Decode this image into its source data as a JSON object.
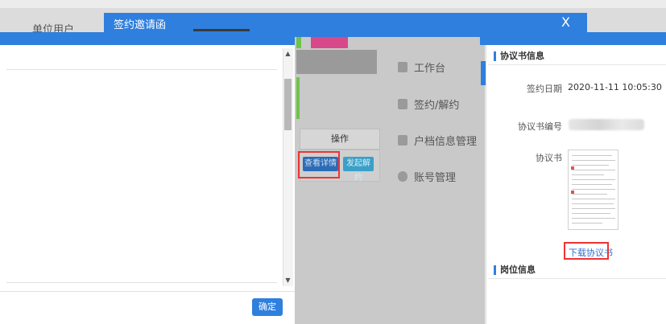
{
  "background": {
    "unit_user": "单位用户",
    "operation_header": "操作",
    "view_detail": "查看详情",
    "unsign": "发起解约",
    "nav": [
      {
        "label": "工作台",
        "icon": "calendar-icon"
      },
      {
        "label": "签约/解约",
        "icon": "document-icon"
      },
      {
        "label": "户档信息管理",
        "icon": "id-card-icon"
      },
      {
        "label": "账号管理",
        "icon": "user-icon"
      }
    ]
  },
  "dialog": {
    "title": "签约邀请函",
    "close": "X"
  },
  "left_modal": {
    "confirm_label": "确定"
  },
  "right_panel": {
    "agreement_section_title": "协议书信息",
    "sign_date_label": "签约日期",
    "sign_date_value": "2020-11-11 10:05:30",
    "agreement_number_label": "协议书编号",
    "agreement_label": "协议书",
    "download_label": "下载协议书",
    "position_section_title": "岗位信息"
  },
  "colors": {
    "accent": "#2f7fde",
    "highlight_box": "#e33333"
  }
}
